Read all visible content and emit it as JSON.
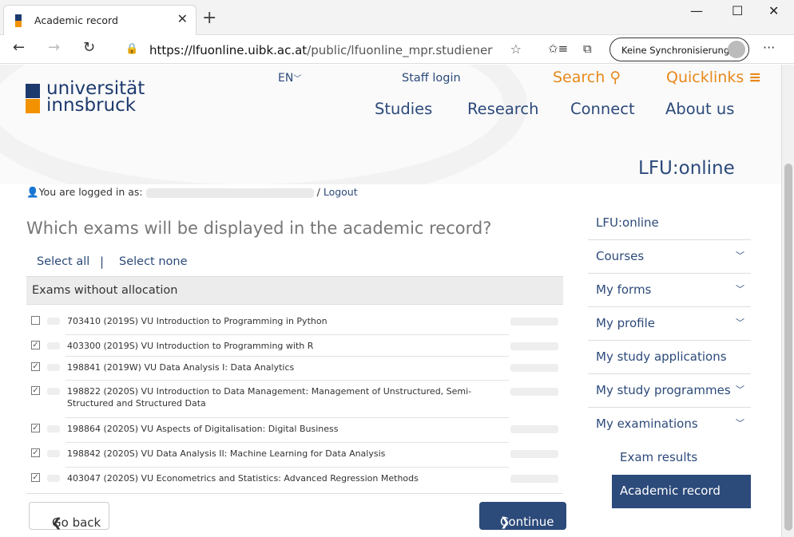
{
  "browser": {
    "tab_title": "Academic record",
    "url_host": "https://lfuonline.uibk.ac.at",
    "url_path": "/public/lfuonline_mpr.studienerfo...",
    "sync_label": "Keine Synchronisierung"
  },
  "header": {
    "logo_line1": "universität",
    "logo_line2": "innsbruck",
    "lang": "EN",
    "staff_login": "Staff login",
    "search": "Search",
    "quicklinks": "Quicklinks",
    "nav": [
      "Studies",
      "Research",
      "Connect",
      "About us"
    ],
    "portal_title": "LFU:online"
  },
  "login": {
    "prefix": "You are logged in as:",
    "logout": "Logout"
  },
  "main": {
    "question": "Which exams will be displayed in the academic record?",
    "select_all": "Select all",
    "separator": "|",
    "select_none": "Select none",
    "group_header": "Exams without allocation",
    "exams": [
      {
        "label": "703410 (2019S) VU Introduction to Programming in Python",
        "checked": false
      },
      {
        "label": "403300 (2019S) VU Introduction to Programming with R",
        "checked": true
      },
      {
        "label": "198841 (2019W) VU Data Analysis I: Data Analytics",
        "checked": true
      },
      {
        "label": "198822 (2020S) VU Introduction to Data Management: Management of Unstructured, Semi-Structured and Structured Data",
        "checked": true
      },
      {
        "label": "198864 (2020S) VU Aspects of Digitalisation: Digital Business",
        "checked": true
      },
      {
        "label": "198842 (2020S) VU Data Analysis II: Machine Learning for Data Analysis",
        "checked": true
      },
      {
        "label": "403047 (2020S) VU Econometrics and Statistics: Advanced Regression Methods",
        "checked": true
      }
    ],
    "go_back": "Go back",
    "continue": "Continue"
  },
  "sidebar": {
    "items": [
      {
        "label": "LFU:online"
      },
      {
        "label": "Courses"
      },
      {
        "label": "My forms"
      },
      {
        "label": "My profile"
      },
      {
        "label": "My study applications"
      },
      {
        "label": "My study programmes"
      },
      {
        "label": "My examinations"
      },
      {
        "label": "Exam results"
      },
      {
        "label": "Academic record"
      }
    ]
  }
}
